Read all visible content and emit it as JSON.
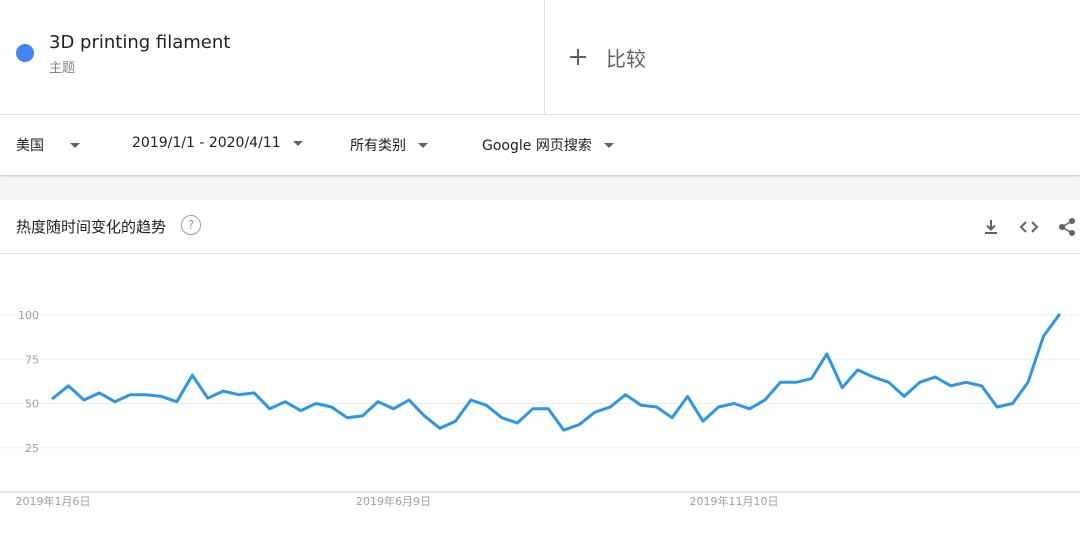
{
  "term": {
    "name": "3D printing filament",
    "type": "主题",
    "color": "#4285f4"
  },
  "compare": {
    "label": "比较"
  },
  "filters": [
    {
      "label": "美国"
    },
    {
      "label": "2019/1/1 - 2020/4/11"
    },
    {
      "label": "所有类别"
    },
    {
      "label": "Google 网页搜索"
    }
  ],
  "panel": {
    "title": "热度随时间变化的趋势",
    "help_symbol": "?",
    "tools": [
      "download-icon",
      "embed-icon",
      "share-icon"
    ]
  },
  "chart_data": {
    "type": "line",
    "title": "",
    "xlabel": "",
    "ylabel": "",
    "ylim": [
      0,
      100
    ],
    "yticks": [
      25,
      50,
      75,
      100
    ],
    "grid": true,
    "line_color": "#2d96e6",
    "x_tick_labels": [
      {
        "index": 0,
        "label": "2019年1月6日"
      },
      {
        "index": 22,
        "label": "2019年6月9日"
      },
      {
        "index": 44,
        "label": "2019年11月10日"
      }
    ],
    "series": [
      {
        "values": [
          53,
          60,
          52,
          56,
          51,
          55,
          55,
          54,
          51,
          66,
          53,
          57,
          55,
          56,
          47,
          51,
          46,
          50,
          48,
          42,
          43,
          51,
          47,
          52,
          43,
          36,
          40,
          52,
          49,
          42,
          39,
          47,
          47,
          35,
          38,
          45,
          48,
          55,
          49,
          48,
          42,
          54,
          40,
          48,
          50,
          47,
          52,
          62,
          62,
          64,
          78,
          59,
          69,
          65,
          62,
          54,
          62,
          65,
          60,
          62,
          60,
          48,
          50,
          62,
          88,
          100
        ]
      }
    ]
  }
}
